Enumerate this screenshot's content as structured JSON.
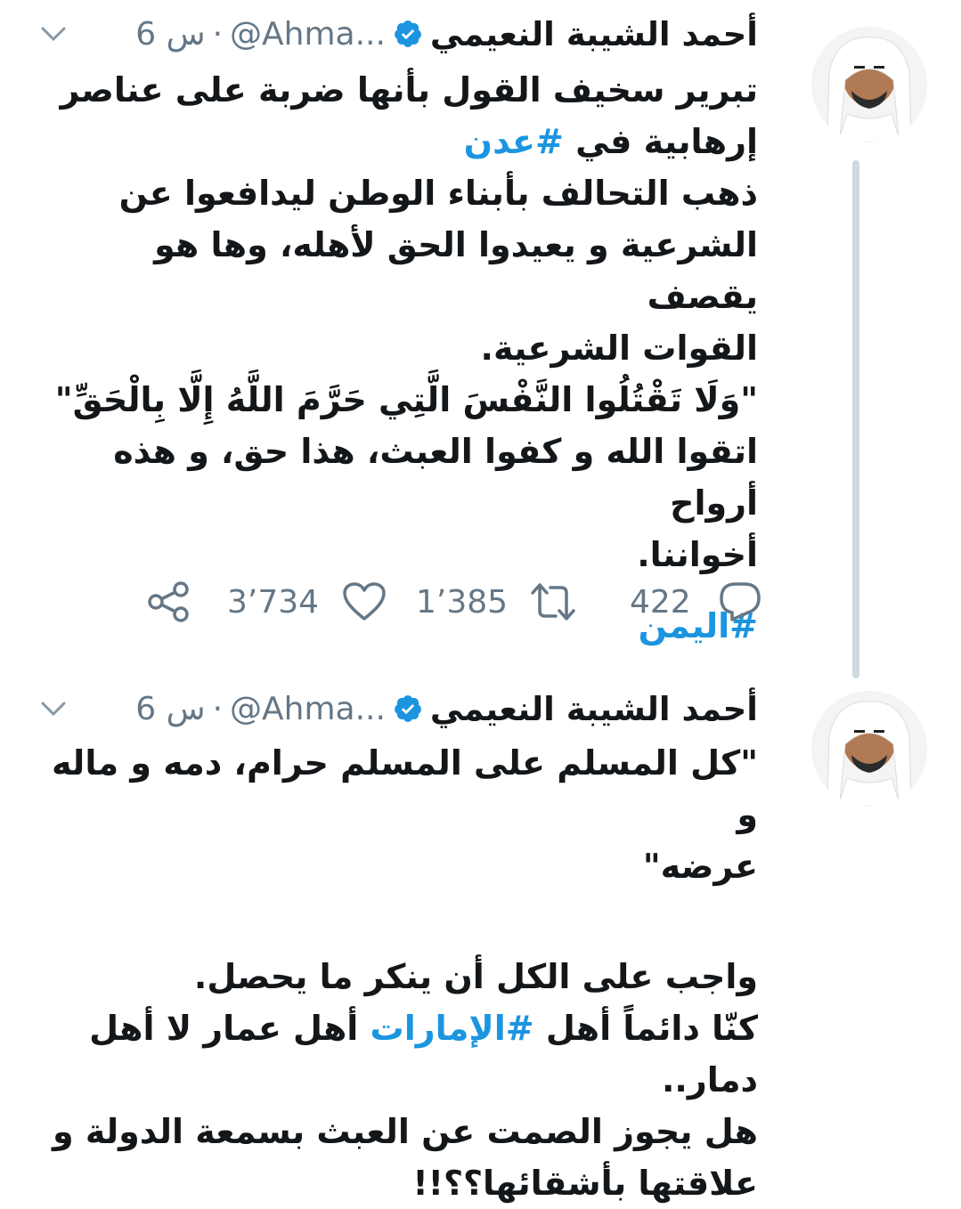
{
  "tweets": [
    {
      "author_name": "أحمد  الشيبة النعيمي",
      "handle": "@Ahma...",
      "time": "6 س",
      "separator": "·",
      "lines": [
        {
          "text": "تبرير سخيف القول بأنها ضربة على عناصر"
        },
        {
          "pre": "إرهابية في ",
          "tag": "#عدن"
        },
        {
          "text": "ذهب التحالف بأبناء الوطن ليدافعوا عن"
        },
        {
          "text": "الشرعية و يعيدوا الحق لأهله، وها هو يقصف"
        },
        {
          "text": "القوات الشرعية."
        },
        {
          "text": "\"وَلَا تَقْتُلُوا النَّفْسَ الَّتِي حَرَّمَ اللَّهُ إِلَّا بِالْحَقِّ\""
        },
        {
          "text": "اتقوا الله و كفوا العبث، هذا حق، و هذه أرواح"
        },
        {
          "text": "أخواننا."
        }
      ],
      "footer_tag": "#اليمن",
      "replies": "422",
      "retweets": "1’385",
      "likes": "3’734"
    },
    {
      "author_name": "أحمد  الشيبة النعيمي",
      "handle": "@Ahma...",
      "time": "6 س",
      "separator": "·",
      "lines": [
        {
          "text": "\"كل المسلم على المسلم حرام، دمه و ماله و"
        },
        {
          "text": "عرضه\""
        },
        {
          "text": "واجب على الكل أن ينكر ما يحصل."
        },
        {
          "pre": "كنّا دائماً أهل ",
          "tag": "#الإمارات",
          "post": " أهل عمار لا أهل دمار.."
        },
        {
          "text": "هل يجوز الصمت عن العبث بسمعة الدولة و"
        },
        {
          "text": "علاقتها بأشقائها؟؟!!"
        }
      ]
    }
  ],
  "icons": {
    "verified": "verified-badge-icon",
    "chevron": "chevron-down-icon",
    "reply": "reply-icon",
    "retweet": "retweet-icon",
    "like": "like-heart-icon",
    "share": "share-icon"
  },
  "colors": {
    "link": "#1b95e0",
    "muted": "#657786",
    "text": "#14171a",
    "thread_line": "#cfd9de"
  }
}
